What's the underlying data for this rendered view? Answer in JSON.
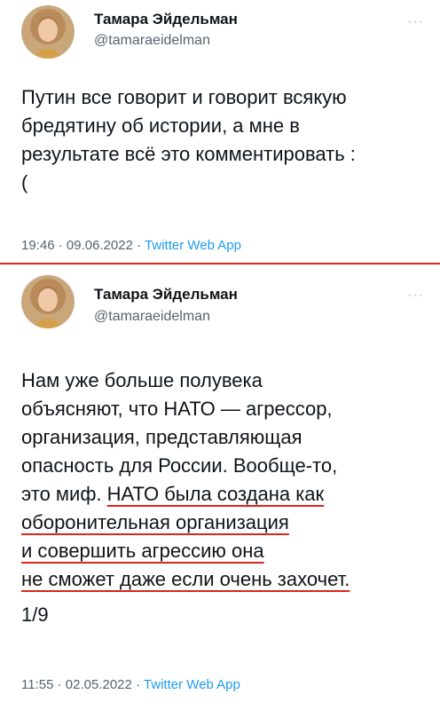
{
  "tweets": [
    {
      "author_name": "Тамара Эйдельман",
      "author_handle": "@tamaraeidelman",
      "more_label": "···",
      "lines": [
        "Путин все говорит и говорит всякую",
        "бредятину об истории, а мне в",
        "результате всё это комментировать :",
        "("
      ],
      "time": "19:46",
      "date": "09.06.2022",
      "app": "Twitter Web App",
      "sep": " · "
    },
    {
      "author_name": "Тамара Эйдельман",
      "author_handle": "@tamaraeidelman",
      "more_label": "···",
      "lines": [
        "Нам уже больше полувека",
        "объясняют, что НАТО — агрессор,",
        "организация, представляющая",
        "опасность для России. Вообще-то,",
        "это миф. ",
        "НАТО была создана как",
        "оборонительная организация",
        "и совершить агрессию она",
        "не сможет даже если очень захочет.",
        "1/9"
      ],
      "time": "11:55",
      "date": "02.05.2022",
      "app": "Twitter Web App",
      "sep": " · "
    }
  ],
  "colors": {
    "separator": "#d9261c",
    "underline": "#d9261c",
    "link": "#1d9bf0",
    "secondary_text": "#536471"
  }
}
